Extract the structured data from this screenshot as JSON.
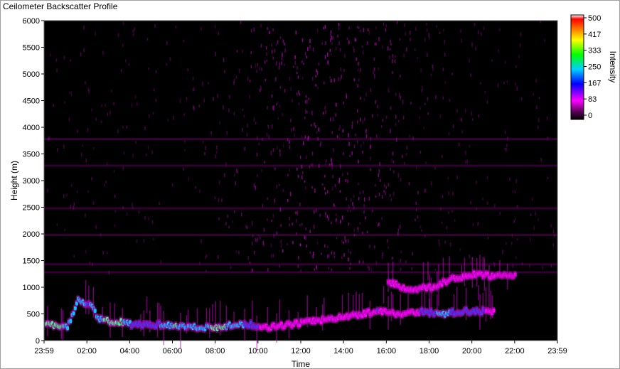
{
  "window": {
    "title": "Ceilometer Backscatter Profile"
  },
  "chart_data": {
    "type": "heatmap",
    "title": "Ceilometer Backscatter Profile",
    "xlabel": "Time",
    "ylabel": "Height (m)",
    "x_ticks": [
      "23:59",
      "02:00",
      "04:00",
      "06:00",
      "08:00",
      "10:00",
      "12:00",
      "14:00",
      "16:00",
      "18:00",
      "20:00",
      "22:00",
      "23:59"
    ],
    "y_ticks": [
      "0",
      "500",
      "1000",
      "1500",
      "2000",
      "2500",
      "3000",
      "3500",
      "4000",
      "4500",
      "5000",
      "5500",
      "6000"
    ],
    "ylim": [
      0,
      6000
    ],
    "xlim_hours": [
      0,
      24
    ],
    "colorbar": {
      "label": "Intensity",
      "ticks": [
        "0",
        "83",
        "167",
        "250",
        "333",
        "417",
        "500"
      ],
      "range": [
        0,
        500
      ],
      "colors": [
        "#000000",
        "#a000a0",
        "#ff00ff",
        "#0000ff",
        "#00c0ff",
        "#00ff00",
        "#ffff00",
        "#ff8000",
        "#ff0000",
        "#ffffff"
      ]
    },
    "background_color": "#000000",
    "layers": [
      {
        "description": "Boundary layer / cloud base (intensity ~250-330)",
        "points": [
          {
            "t": 0.0,
            "h": 300,
            "v": 280
          },
          {
            "t": 0.5,
            "h": 280,
            "v": 300
          },
          {
            "t": 1.0,
            "h": 250,
            "v": 260
          },
          {
            "t": 1.5,
            "h": 750,
            "v": 250
          },
          {
            "t": 2.0,
            "h": 700,
            "v": 220
          },
          {
            "t": 2.5,
            "h": 400,
            "v": 260
          },
          {
            "t": 3.0,
            "h": 350,
            "v": 300
          },
          {
            "t": 3.5,
            "h": 350,
            "v": 290
          },
          {
            "t": 4.0,
            "h": 300,
            "v": 220
          },
          {
            "t": 4.5,
            "h": 300,
            "v": 200
          },
          {
            "t": 5.5,
            "h": 300,
            "v": 230
          },
          {
            "t": 6.0,
            "h": 280,
            "v": 280
          },
          {
            "t": 7.0,
            "h": 250,
            "v": 240
          },
          {
            "t": 8.0,
            "h": 250,
            "v": 290
          },
          {
            "t": 9.0,
            "h": 300,
            "v": 250
          },
          {
            "t": 9.5,
            "h": 300,
            "v": 200
          },
          {
            "t": 10.5,
            "h": 250,
            "v": 130
          },
          {
            "t": 14.0,
            "h": 450,
            "v": 160
          },
          {
            "t": 15.5,
            "h": 550,
            "v": 170
          },
          {
            "t": 16.5,
            "h": 500,
            "v": 160
          },
          {
            "t": 17.5,
            "h": 550,
            "v": 170
          },
          {
            "t": 18.5,
            "h": 500,
            "v": 240
          },
          {
            "t": 19.5,
            "h": 550,
            "v": 200
          },
          {
            "t": 20.5,
            "h": 550,
            "v": 170
          },
          {
            "t": 21.0,
            "h": 550,
            "v": 150
          }
        ]
      },
      {
        "description": "Upper layer (intensity ~83-167)",
        "points": [
          {
            "t": 16.0,
            "h": 1100,
            "v": 120
          },
          {
            "t": 17.0,
            "h": 950,
            "v": 120
          },
          {
            "t": 18.0,
            "h": 1000,
            "v": 110
          },
          {
            "t": 19.0,
            "h": 1150,
            "v": 110
          },
          {
            "t": 20.0,
            "h": 1250,
            "v": 100
          },
          {
            "t": 21.0,
            "h": 1200,
            "v": 100
          },
          {
            "t": 22.0,
            "h": 1250,
            "v": 90
          }
        ]
      }
    ],
    "noise_peak_hour": 13.0
  }
}
